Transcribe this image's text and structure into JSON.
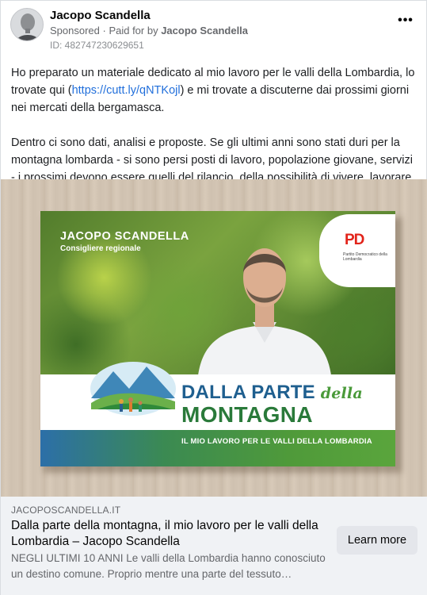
{
  "header": {
    "author": "Jacopo Scandella",
    "sponsored": "Sponsored",
    "paid_prefix": " · Paid for by ",
    "paid_by": "Jacopo Scandella",
    "ad_id": "ID: 482747230629651",
    "more_icon": "more-options-icon"
  },
  "body": {
    "p1_before": "Ho preparato un materiale dedicato al mio lavoro per le valli della Lombardia, lo trovate qui (",
    "p1_link": "https://cutt.ly/qNTKojl",
    "p1_after": ") e mi trovate a discuterne dai prossimi giorni nei mercati della bergamasca.",
    "p2": "Dentro ci sono dati, analisi e proposte. Se gli ultimi anni sono stati duri per la montagna lombarda - si sono persi posti di lavoro, popolazione giovane, servizi - i prossimi devono essere quelli del rilancio, della possibilità di vivere, lavorare e…"
  },
  "creative": {
    "name": "JACOPO SCANDELLA",
    "role": "Consigliere regionale",
    "logo_text": "PD",
    "logo_sub": "Partito Democratico della Lombardia",
    "title_main": "DALLA PARTE ",
    "title_italic": "della",
    "title_line2": "MONTAGNA",
    "subtitle": "IL MIO LAVORO PER LE VALLI DELLA LOMBARDIA"
  },
  "footer": {
    "domain": "JACOPOSCANDELLA.IT",
    "title": "Dalla parte della montagna, il mio lavoro per le valli della Lombardia – Jacopo Scandella",
    "description": "NEGLI ULTIMI 10 ANNI Le valli della Lombardia hanno conosciuto un destino comune. Proprio mentre una parte del tessuto…",
    "cta": "Learn more"
  },
  "colors": {
    "link": "#216fdb",
    "muted": "#65676b",
    "footer_bg": "#f0f2f5",
    "button_bg": "#e4e6eb"
  }
}
